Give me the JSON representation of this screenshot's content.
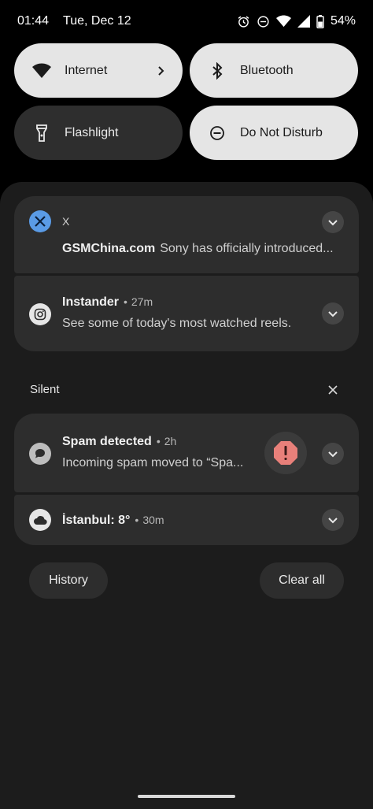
{
  "status_bar": {
    "time": "01:44",
    "date": "Tue, Dec 12",
    "battery": "54%",
    "icons": [
      "alarm-icon",
      "dnd-icon",
      "wifi-icon",
      "signal-icon",
      "battery-icon"
    ]
  },
  "quick_tiles": [
    {
      "label": "Internet",
      "icon": "wifi-icon",
      "state": "on"
    },
    {
      "label": "Bluetooth",
      "icon": "bluetooth-icon",
      "state": "on"
    },
    {
      "label": "Flashlight",
      "icon": "flashlight-icon",
      "state": "off"
    },
    {
      "label": "Do Not Disturb",
      "icon": "do-not-disturb-icon",
      "state": "on"
    }
  ],
  "notifications": [
    {
      "app": "X",
      "title": "GSMChina.com",
      "body": "Sony has officially introduced...",
      "icon": "x-logo-icon"
    },
    {
      "app": "Instander",
      "time": "27m",
      "body": "See some of today's most watched reels.",
      "icon": "instagram-icon"
    }
  ],
  "silent": {
    "label": "Silent",
    "items": [
      {
        "title": "Spam detected",
        "time": "2h",
        "body": "Incoming spam moved to “Spa...",
        "icon": "chat-bubble-icon"
      },
      {
        "title": "İstanbul: 8°",
        "time": "30m",
        "icon": "cloud-icon"
      }
    ]
  },
  "actions": {
    "history": "History",
    "clear_all": "Clear all"
  },
  "colors": {
    "background": "#000000",
    "shade": "#1c1c1c",
    "card": "#2d2d2d",
    "tile_on": "#e5e5e5",
    "tile_off": "#2e2e2e",
    "x_blue": "#5a9be6",
    "spam_red": "#e8807a"
  }
}
